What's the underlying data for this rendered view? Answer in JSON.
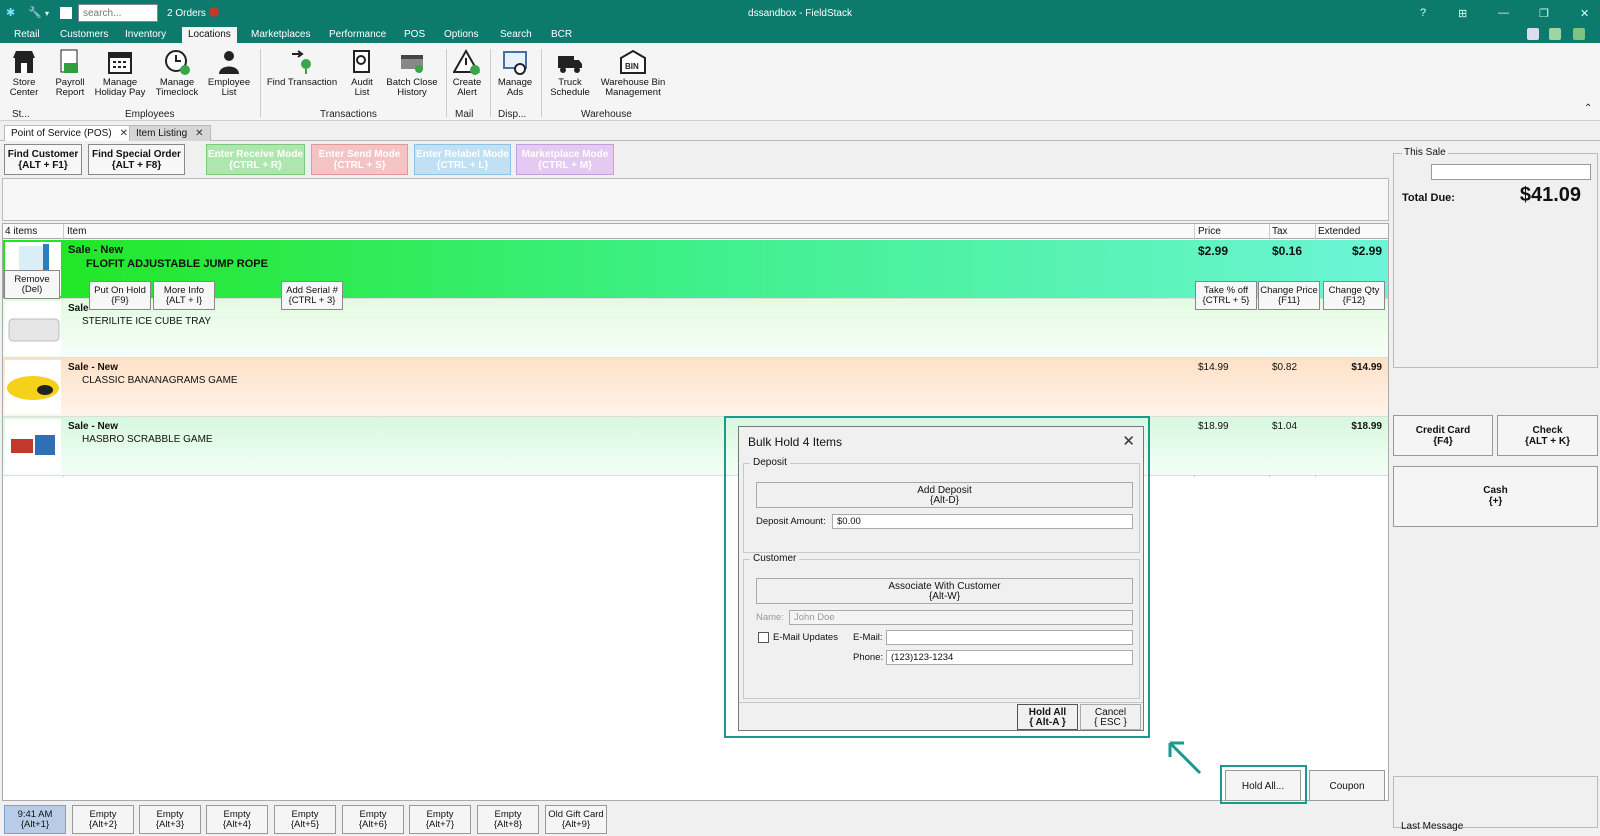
{
  "app": {
    "search_placeholder": "search...",
    "orders": "2 Orders",
    "window_title": "dssandbox - FieldStack"
  },
  "menu": [
    "Retail",
    "Customers",
    "Inventory",
    "Locations",
    "Marketplaces",
    "Performance",
    "POS",
    "Options",
    "Search",
    "BCR"
  ],
  "ribbon": {
    "buttons": [
      [
        "Store",
        "Center"
      ],
      [
        "Payroll",
        "Report"
      ],
      [
        "Manage",
        "Holiday Pay"
      ],
      [
        "Manage",
        "Timeclock"
      ],
      [
        "Employee",
        "List"
      ],
      [
        "Find Transaction",
        ""
      ],
      [
        "Audit",
        "List"
      ],
      [
        "Batch Close",
        "History"
      ],
      [
        "Create",
        "Alert"
      ],
      [
        "Manage",
        "Ads"
      ],
      [
        "Truck",
        "Schedule"
      ],
      [
        "Warehouse Bin",
        "Management"
      ]
    ],
    "groups": [
      "St...",
      "Employees",
      "Transactions",
      "Mail",
      "Disp...",
      "Warehouse"
    ]
  },
  "tabs": [
    "Point of Service (POS)",
    "Item Listing"
  ],
  "toolbar": {
    "find_customer": [
      "Find Customer",
      "{ALT + F1}"
    ],
    "find_special": [
      "Find Special Order",
      "{ALT + F8}"
    ],
    "receive": [
      "Enter Receive Mode",
      "{CTRL + R}"
    ],
    "send": [
      "Enter Send Mode",
      "{CTRL + S}"
    ],
    "relabel": [
      "Enter Relabel Mode",
      "{CTRL + L}"
    ],
    "marketplace": [
      "Marketplace Mode",
      "{CTRL + M}"
    ]
  },
  "grid": {
    "count": "4 items",
    "h_item": "Item",
    "h_price": "Price",
    "h_tax": "Tax",
    "h_ext": "Extended",
    "rows": [
      {
        "status": "Sale - New",
        "desc": "FLOFIT ADJUSTABLE JUMP ROPE",
        "price": "$2.99",
        "tax": "$0.16",
        "ext": "$2.99"
      },
      {
        "status": "Sale",
        "desc": "STERILITE ICE CUBE TRAY",
        "price": "",
        "tax": "",
        "ext": ""
      },
      {
        "status": "Sale - New",
        "desc": "CLASSIC BANANAGRAMS GAME",
        "price": "$14.99",
        "tax": "$0.82",
        "ext": "$14.99"
      },
      {
        "status": "Sale - New",
        "desc": "HASBRO SCRABBLE GAME",
        "price": "$18.99",
        "tax": "$1.04",
        "ext": "$18.99"
      }
    ]
  },
  "row_actions": {
    "remove": [
      "Remove",
      "(Del)"
    ],
    "hold": [
      "Put On Hold",
      "{F9}"
    ],
    "info": [
      "More Info",
      "{ALT + I}"
    ],
    "serial": [
      "Add Serial #",
      "{CTRL + 3}"
    ],
    "pct": [
      "Take % off",
      "{CTRL + 5}"
    ],
    "price": [
      "Change Price",
      "{F11}"
    ],
    "qty": [
      "Change Qty",
      "{F12}"
    ]
  },
  "sale": {
    "label": "This Sale",
    "total_label": "Total Due:",
    "total": "$41.09"
  },
  "pay": {
    "credit": [
      "Credit Card",
      "{F4}"
    ],
    "check": [
      "Check",
      "{ALT + K}"
    ],
    "cash": [
      "Cash",
      "{+}"
    ],
    "hold_all": "Hold All...",
    "coupon": "Coupon",
    "last_message": "Last Message"
  },
  "bottom": [
    [
      "9:41 AM",
      "{Alt+1}"
    ],
    [
      "Empty",
      "{Alt+2}"
    ],
    [
      "Empty",
      "{Alt+3}"
    ],
    [
      "Empty",
      "{Alt+4}"
    ],
    [
      "Empty",
      "{Alt+5}"
    ],
    [
      "Empty",
      "{Alt+6}"
    ],
    [
      "Empty",
      "{Alt+7}"
    ],
    [
      "Empty",
      "{Alt+8}"
    ],
    [
      "Old Gift Card",
      "{Alt+9}"
    ]
  ],
  "dialog": {
    "title": "Bulk Hold 4 Items",
    "deposit_legend": "Deposit",
    "add_deposit": [
      "Add Deposit",
      "{Alt-D}"
    ],
    "deposit_label": "Deposit Amount:",
    "deposit_value": "$0.00",
    "customer_legend": "Customer",
    "associate": [
      "Associate With Customer",
      "{Alt-W}"
    ],
    "name_label": "Name:",
    "name_placeholder": "John Doe",
    "email_updates": "E-Mail Updates",
    "email_label": "E-Mail:",
    "phone_label": "Phone:",
    "phone_value": "(123)123-1234",
    "hold_all": [
      "Hold All",
      "{ Alt-A }"
    ],
    "cancel": [
      "Cancel",
      "{ ESC }"
    ]
  },
  "colors": {
    "teal": "#0c7b6e",
    "highlight": "#1a9a8c"
  }
}
